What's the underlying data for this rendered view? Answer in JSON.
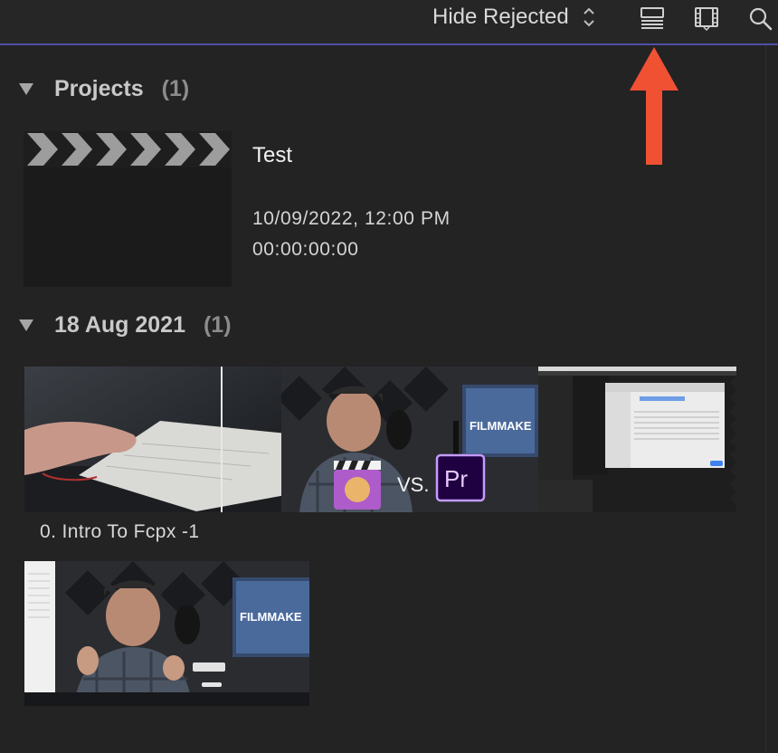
{
  "toolbar": {
    "filter_label": "Hide Rejected",
    "icons": [
      "chevron-updown-icon",
      "list-view-icon",
      "filmstrip-view-icon",
      "search-icon"
    ]
  },
  "annotation": {
    "arrow_color": "#f05133"
  },
  "sections": [
    {
      "title": "Projects",
      "count": "(1)"
    },
    {
      "title": "18 Aug 2021",
      "count": "(1)"
    }
  ],
  "project": {
    "name": "Test",
    "date": "10/09/2022, 12:00 PM",
    "timecode": "00:00:00:00"
  },
  "clips": [
    {
      "label": "0. Intro To Fcpx -1",
      "frames": [
        "hand-on-keyboard",
        "fcpx-vs-premiere",
        "finder-window-screen"
      ],
      "overlay_text": {
        "vs": "VS.",
        "pr": "Pr",
        "brand": "FILMMAKE"
      }
    },
    {
      "label": "",
      "frames": [
        "presenter-at-desk"
      ],
      "overlay_text": {
        "brand": "FILMMAKE"
      }
    }
  ]
}
